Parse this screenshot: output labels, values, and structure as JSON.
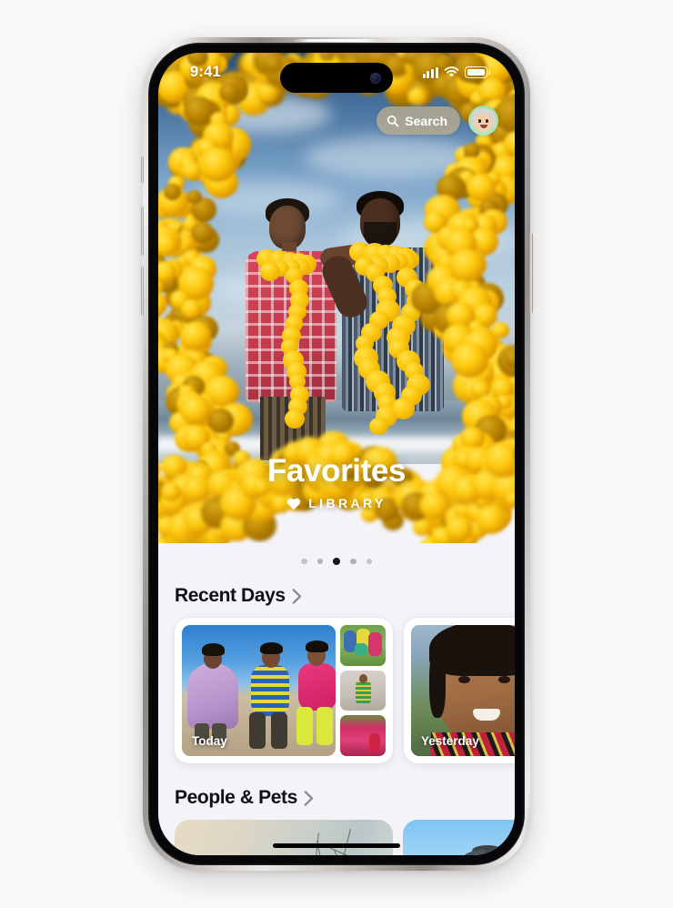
{
  "device": {
    "name": "iPhone",
    "frame_color": "natural-titanium"
  },
  "status_bar": {
    "time": "9:41",
    "cellular_icon": "cellular-bars-icon",
    "cellular_bars": 4,
    "wifi_icon": "wifi-icon",
    "battery_icon": "battery-full-icon",
    "battery_level": 100
  },
  "top_controls": {
    "search": {
      "label": "Search",
      "icon": "search-icon"
    },
    "avatar": {
      "name": "account-avatar",
      "type": "memoji"
    }
  },
  "hero": {
    "title": "Favorites",
    "subtitle": "LIBRARY",
    "subtitle_icon": "heart-icon",
    "alt": "Two people wearing yellow marigold garlands standing on a beach, framed by marigold flowers"
  },
  "pager": {
    "total": 5,
    "active_index": 2
  },
  "sections": [
    {
      "id": "recent-days",
      "title": "Recent Days",
      "chevron_icon": "chevron-right-icon",
      "cards": [
        {
          "id": "today",
          "label": "Today",
          "main_alt": "Three girls in colorful clothes sitting on a sand dune under a blue sky",
          "thumbs": [
            {
              "alt": "Children playing together on green grass"
            },
            {
              "alt": "Girl in a green patterned dress by a textured wall"
            },
            {
              "alt": "Field of bright pink flowers"
            }
          ]
        },
        {
          "id": "yesterday",
          "label": "Yesterday",
          "main_alt": "Close-up portrait of a smiling young girl"
        }
      ]
    },
    {
      "id": "people-and-pets",
      "title": "People & Pets",
      "chevron_icon": "chevron-right-icon",
      "cards": [
        {
          "id": "pp-1",
          "alt": "Beach scene with bare tree branches"
        },
        {
          "id": "pp-2",
          "alt": "Bird flying against a blue sky"
        }
      ]
    }
  ],
  "home_indicator": {
    "name": "home-indicator"
  },
  "colors": {
    "page_background": "#fafafa",
    "screen_background": "#f4f4f8",
    "search_pill": "#c4b28e",
    "text_primary": "#101014",
    "text_on_photo": "#ffffff",
    "dot_active": "#17171a",
    "dot_inactive": "#c2c2cb",
    "marigold": "#fbc80f"
  }
}
